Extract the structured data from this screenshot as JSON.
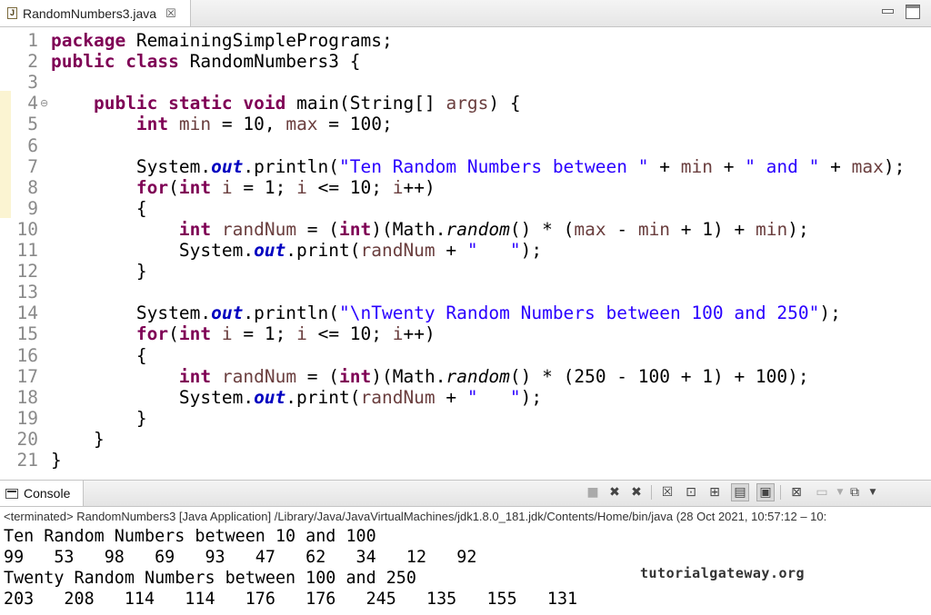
{
  "editor": {
    "tab_icon": "J",
    "tab_title": "RandomNumbers3.java",
    "tab_close": "☒",
    "lines": [
      {
        "num": "1",
        "segs": [
          {
            "t": "kw",
            "v": "package"
          },
          {
            "t": "",
            "v": " RemainingSimplePrograms;"
          }
        ]
      },
      {
        "num": "2",
        "segs": [
          {
            "t": "kw",
            "v": "public"
          },
          {
            "t": "",
            "v": " "
          },
          {
            "t": "kw",
            "v": "class"
          },
          {
            "t": "",
            "v": " RandomNumbers3 {"
          }
        ]
      },
      {
        "num": "3",
        "segs": []
      },
      {
        "num": "4",
        "fold": true,
        "segs": [
          {
            "t": "",
            "v": "    "
          },
          {
            "t": "kw",
            "v": "public"
          },
          {
            "t": "",
            "v": " "
          },
          {
            "t": "kw",
            "v": "static"
          },
          {
            "t": "",
            "v": " "
          },
          {
            "t": "kw",
            "v": "void"
          },
          {
            "t": "",
            "v": " main(String[] "
          },
          {
            "t": "var",
            "v": "args"
          },
          {
            "t": "",
            "v": ") {"
          }
        ]
      },
      {
        "num": "5",
        "segs": [
          {
            "t": "",
            "v": "        "
          },
          {
            "t": "kw",
            "v": "int"
          },
          {
            "t": "",
            "v": " "
          },
          {
            "t": "var",
            "v": "min"
          },
          {
            "t": "",
            "v": " = 10, "
          },
          {
            "t": "var",
            "v": "max"
          },
          {
            "t": "",
            "v": " = 100;"
          }
        ]
      },
      {
        "num": "6",
        "segs": []
      },
      {
        "num": "7",
        "segs": [
          {
            "t": "",
            "v": "        System."
          },
          {
            "t": "fld",
            "v": "out"
          },
          {
            "t": "",
            "v": ".println("
          },
          {
            "t": "str",
            "v": "\"Ten Random Numbers between \""
          },
          {
            "t": "",
            "v": " + "
          },
          {
            "t": "var",
            "v": "min"
          },
          {
            "t": "",
            "v": " + "
          },
          {
            "t": "str",
            "v": "\" and \""
          },
          {
            "t": "",
            "v": " + "
          },
          {
            "t": "var",
            "v": "max"
          },
          {
            "t": "",
            "v": ");"
          }
        ]
      },
      {
        "num": "8",
        "segs": [
          {
            "t": "",
            "v": "        "
          },
          {
            "t": "kw",
            "v": "for"
          },
          {
            "t": "",
            "v": "("
          },
          {
            "t": "kw",
            "v": "int"
          },
          {
            "t": "",
            "v": " "
          },
          {
            "t": "var",
            "v": "i"
          },
          {
            "t": "",
            "v": " = 1; "
          },
          {
            "t": "var",
            "v": "i"
          },
          {
            "t": "",
            "v": " <= 10; "
          },
          {
            "t": "var",
            "v": "i"
          },
          {
            "t": "",
            "v": "++)"
          }
        ]
      },
      {
        "num": "9",
        "segs": [
          {
            "t": "",
            "v": "        {"
          }
        ]
      },
      {
        "num": "10",
        "segs": [
          {
            "t": "",
            "v": "            "
          },
          {
            "t": "kw",
            "v": "int"
          },
          {
            "t": "",
            "v": " "
          },
          {
            "t": "var",
            "v": "randNum"
          },
          {
            "t": "",
            "v": " = ("
          },
          {
            "t": "kw",
            "v": "int"
          },
          {
            "t": "",
            "v": ")(Math."
          },
          {
            "t": "ital",
            "v": "random"
          },
          {
            "t": "",
            "v": "() * ("
          },
          {
            "t": "var",
            "v": "max"
          },
          {
            "t": "",
            "v": " - "
          },
          {
            "t": "var",
            "v": "min"
          },
          {
            "t": "",
            "v": " + 1) + "
          },
          {
            "t": "var",
            "v": "min"
          },
          {
            "t": "",
            "v": ");"
          }
        ]
      },
      {
        "num": "11",
        "segs": [
          {
            "t": "",
            "v": "            System."
          },
          {
            "t": "fld",
            "v": "out"
          },
          {
            "t": "",
            "v": ".print("
          },
          {
            "t": "var",
            "v": "randNum"
          },
          {
            "t": "",
            "v": " + "
          },
          {
            "t": "str",
            "v": "\"   \""
          },
          {
            "t": "",
            "v": ");"
          }
        ]
      },
      {
        "num": "12",
        "segs": [
          {
            "t": "",
            "v": "        }"
          }
        ]
      },
      {
        "num": "13",
        "segs": []
      },
      {
        "num": "14",
        "segs": [
          {
            "t": "",
            "v": "        System."
          },
          {
            "t": "fld",
            "v": "out"
          },
          {
            "t": "",
            "v": ".println("
          },
          {
            "t": "str",
            "v": "\"\\nTwenty Random Numbers between 100 and 250\""
          },
          {
            "t": "",
            "v": ");"
          }
        ]
      },
      {
        "num": "15",
        "segs": [
          {
            "t": "",
            "v": "        "
          },
          {
            "t": "kw",
            "v": "for"
          },
          {
            "t": "",
            "v": "("
          },
          {
            "t": "kw",
            "v": "int"
          },
          {
            "t": "",
            "v": " "
          },
          {
            "t": "var",
            "v": "i"
          },
          {
            "t": "",
            "v": " = 1; "
          },
          {
            "t": "var",
            "v": "i"
          },
          {
            "t": "",
            "v": " <= 10; "
          },
          {
            "t": "var",
            "v": "i"
          },
          {
            "t": "",
            "v": "++)"
          }
        ]
      },
      {
        "num": "16",
        "segs": [
          {
            "t": "",
            "v": "        {"
          }
        ]
      },
      {
        "num": "17",
        "segs": [
          {
            "t": "",
            "v": "            "
          },
          {
            "t": "kw",
            "v": "int"
          },
          {
            "t": "",
            "v": " "
          },
          {
            "t": "var",
            "v": "randNum"
          },
          {
            "t": "",
            "v": " = ("
          },
          {
            "t": "kw",
            "v": "int"
          },
          {
            "t": "",
            "v": ")(Math."
          },
          {
            "t": "ital",
            "v": "random"
          },
          {
            "t": "",
            "v": "() * (250 - 100 + 1) + 100);"
          }
        ]
      },
      {
        "num": "18",
        "segs": [
          {
            "t": "",
            "v": "            System."
          },
          {
            "t": "fld",
            "v": "out"
          },
          {
            "t": "",
            "v": ".print("
          },
          {
            "t": "var",
            "v": "randNum"
          },
          {
            "t": "",
            "v": " + "
          },
          {
            "t": "str",
            "v": "\"   \""
          },
          {
            "t": "",
            "v": ");"
          }
        ]
      },
      {
        "num": "19",
        "segs": [
          {
            "t": "",
            "v": "        }"
          }
        ]
      },
      {
        "num": "20",
        "segs": [
          {
            "t": "",
            "v": "    }"
          }
        ]
      },
      {
        "num": "21",
        "segs": [
          {
            "t": "",
            "v": "}"
          }
        ]
      }
    ]
  },
  "console": {
    "tab_title": "Console",
    "header": "<terminated> RandomNumbers3 [Java Application] /Library/Java/JavaVirtualMachines/jdk1.8.0_181.jdk/Contents/Home/bin/java  (28 Oct 2021, 10:57:12 – 10:",
    "output": [
      "Ten Random Numbers between 10 and 100",
      "99   53   98   69   93   47   62   34   12   92",
      "Twenty Random Numbers between 100 and 250",
      "203   208   114   114   176   176   245   135   155   131"
    ]
  },
  "watermark": "tutorialgateway.org",
  "colors": {
    "keyword": "#7f0055",
    "string": "#2a00ff",
    "field": "#0000c0",
    "local_var": "#6a3e3e",
    "line_number": "#8a8a8a"
  }
}
